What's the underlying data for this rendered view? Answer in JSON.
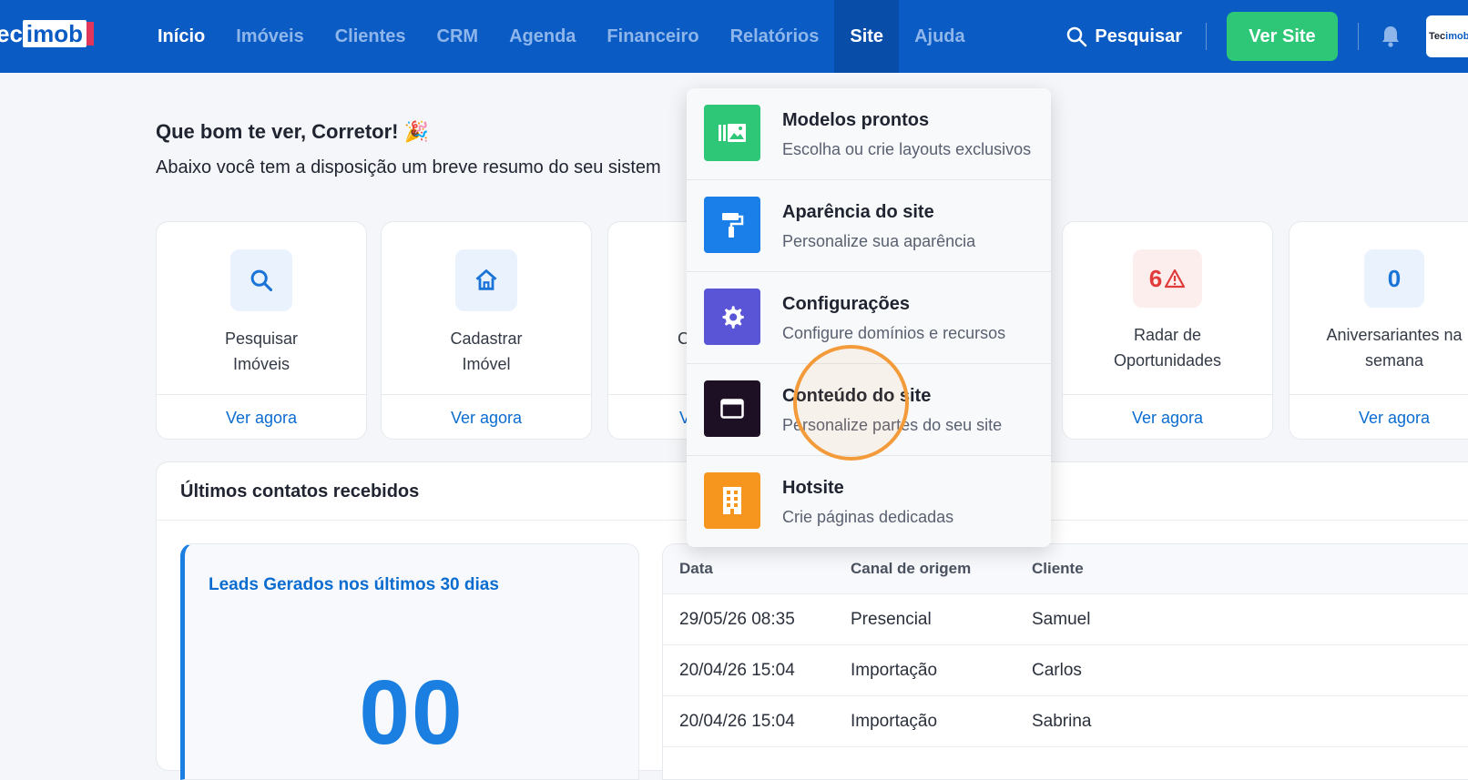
{
  "brand": {
    "logo_left": "ec",
    "logo_right": "imob",
    "logo_tag": ""
  },
  "nav": {
    "items": [
      "Início",
      "Imóveis",
      "Clientes",
      "CRM",
      "Agenda",
      "Financeiro",
      "Relatórios",
      "Site",
      "Ajuda"
    ],
    "search_label": "Pesquisar",
    "ver_site": "Ver Site"
  },
  "avatar": {
    "text_a": "Tec",
    "text_b": "imob"
  },
  "greeting": {
    "title": "Que bom te ver, Corretor! 🎉",
    "subtitle": "Abaixo você tem a disposição um breve resumo do seu sistem"
  },
  "cards": [
    {
      "label_line1": "Pesquisar",
      "label_line2": "Imóveis",
      "cta": "Ver agora"
    },
    {
      "label_line1": "Cadastrar",
      "label_line2": "Imóvel",
      "cta": "Ver agora"
    },
    {
      "label_line1": "C",
      "label_line2": "",
      "cta": "V"
    },
    {
      "count": "6",
      "label_line1": "Radar de",
      "label_line2": "Oportunidades",
      "cta": "Ver agora"
    },
    {
      "count": "0",
      "label_line1": "Aniversariantes na",
      "label_line2": "semana",
      "cta": "Ver agora"
    }
  ],
  "panel": {
    "title": "Últimos contatos recebidos",
    "leads_title": "Leads Gerados nos últimos 30 dias",
    "leads_value": "00",
    "columns": [
      "Data",
      "Canal de origem",
      "Cliente"
    ],
    "rows": [
      [
        "29/05/26 08:35",
        "Presencial",
        "Samuel"
      ],
      [
        "20/04/26 15:04",
        "Importação",
        "Carlos"
      ],
      [
        "20/04/26 15:04",
        "Importação",
        "Sabrina"
      ]
    ]
  },
  "dropdown": {
    "items": [
      {
        "title": "Modelos prontos",
        "desc": "Escolha ou crie layouts exclusivos",
        "color": "#2ec777"
      },
      {
        "title": "Aparência do site",
        "desc": "Personalize sua aparência",
        "color": "#1b7fea"
      },
      {
        "title": "Configurações",
        "desc": "Configure domínios e recursos",
        "color": "#5a55d6"
      },
      {
        "title": "Conteúdo do site",
        "desc": "Personalize partes do seu site",
        "color": "#1e1024"
      },
      {
        "title": "Hotsite",
        "desc": "Crie páginas dedicadas",
        "color": "#f7961e"
      }
    ]
  },
  "colors": {
    "navbar": "#0a5bc4",
    "accent": "#2ec777",
    "link": "#0a6ccf"
  }
}
